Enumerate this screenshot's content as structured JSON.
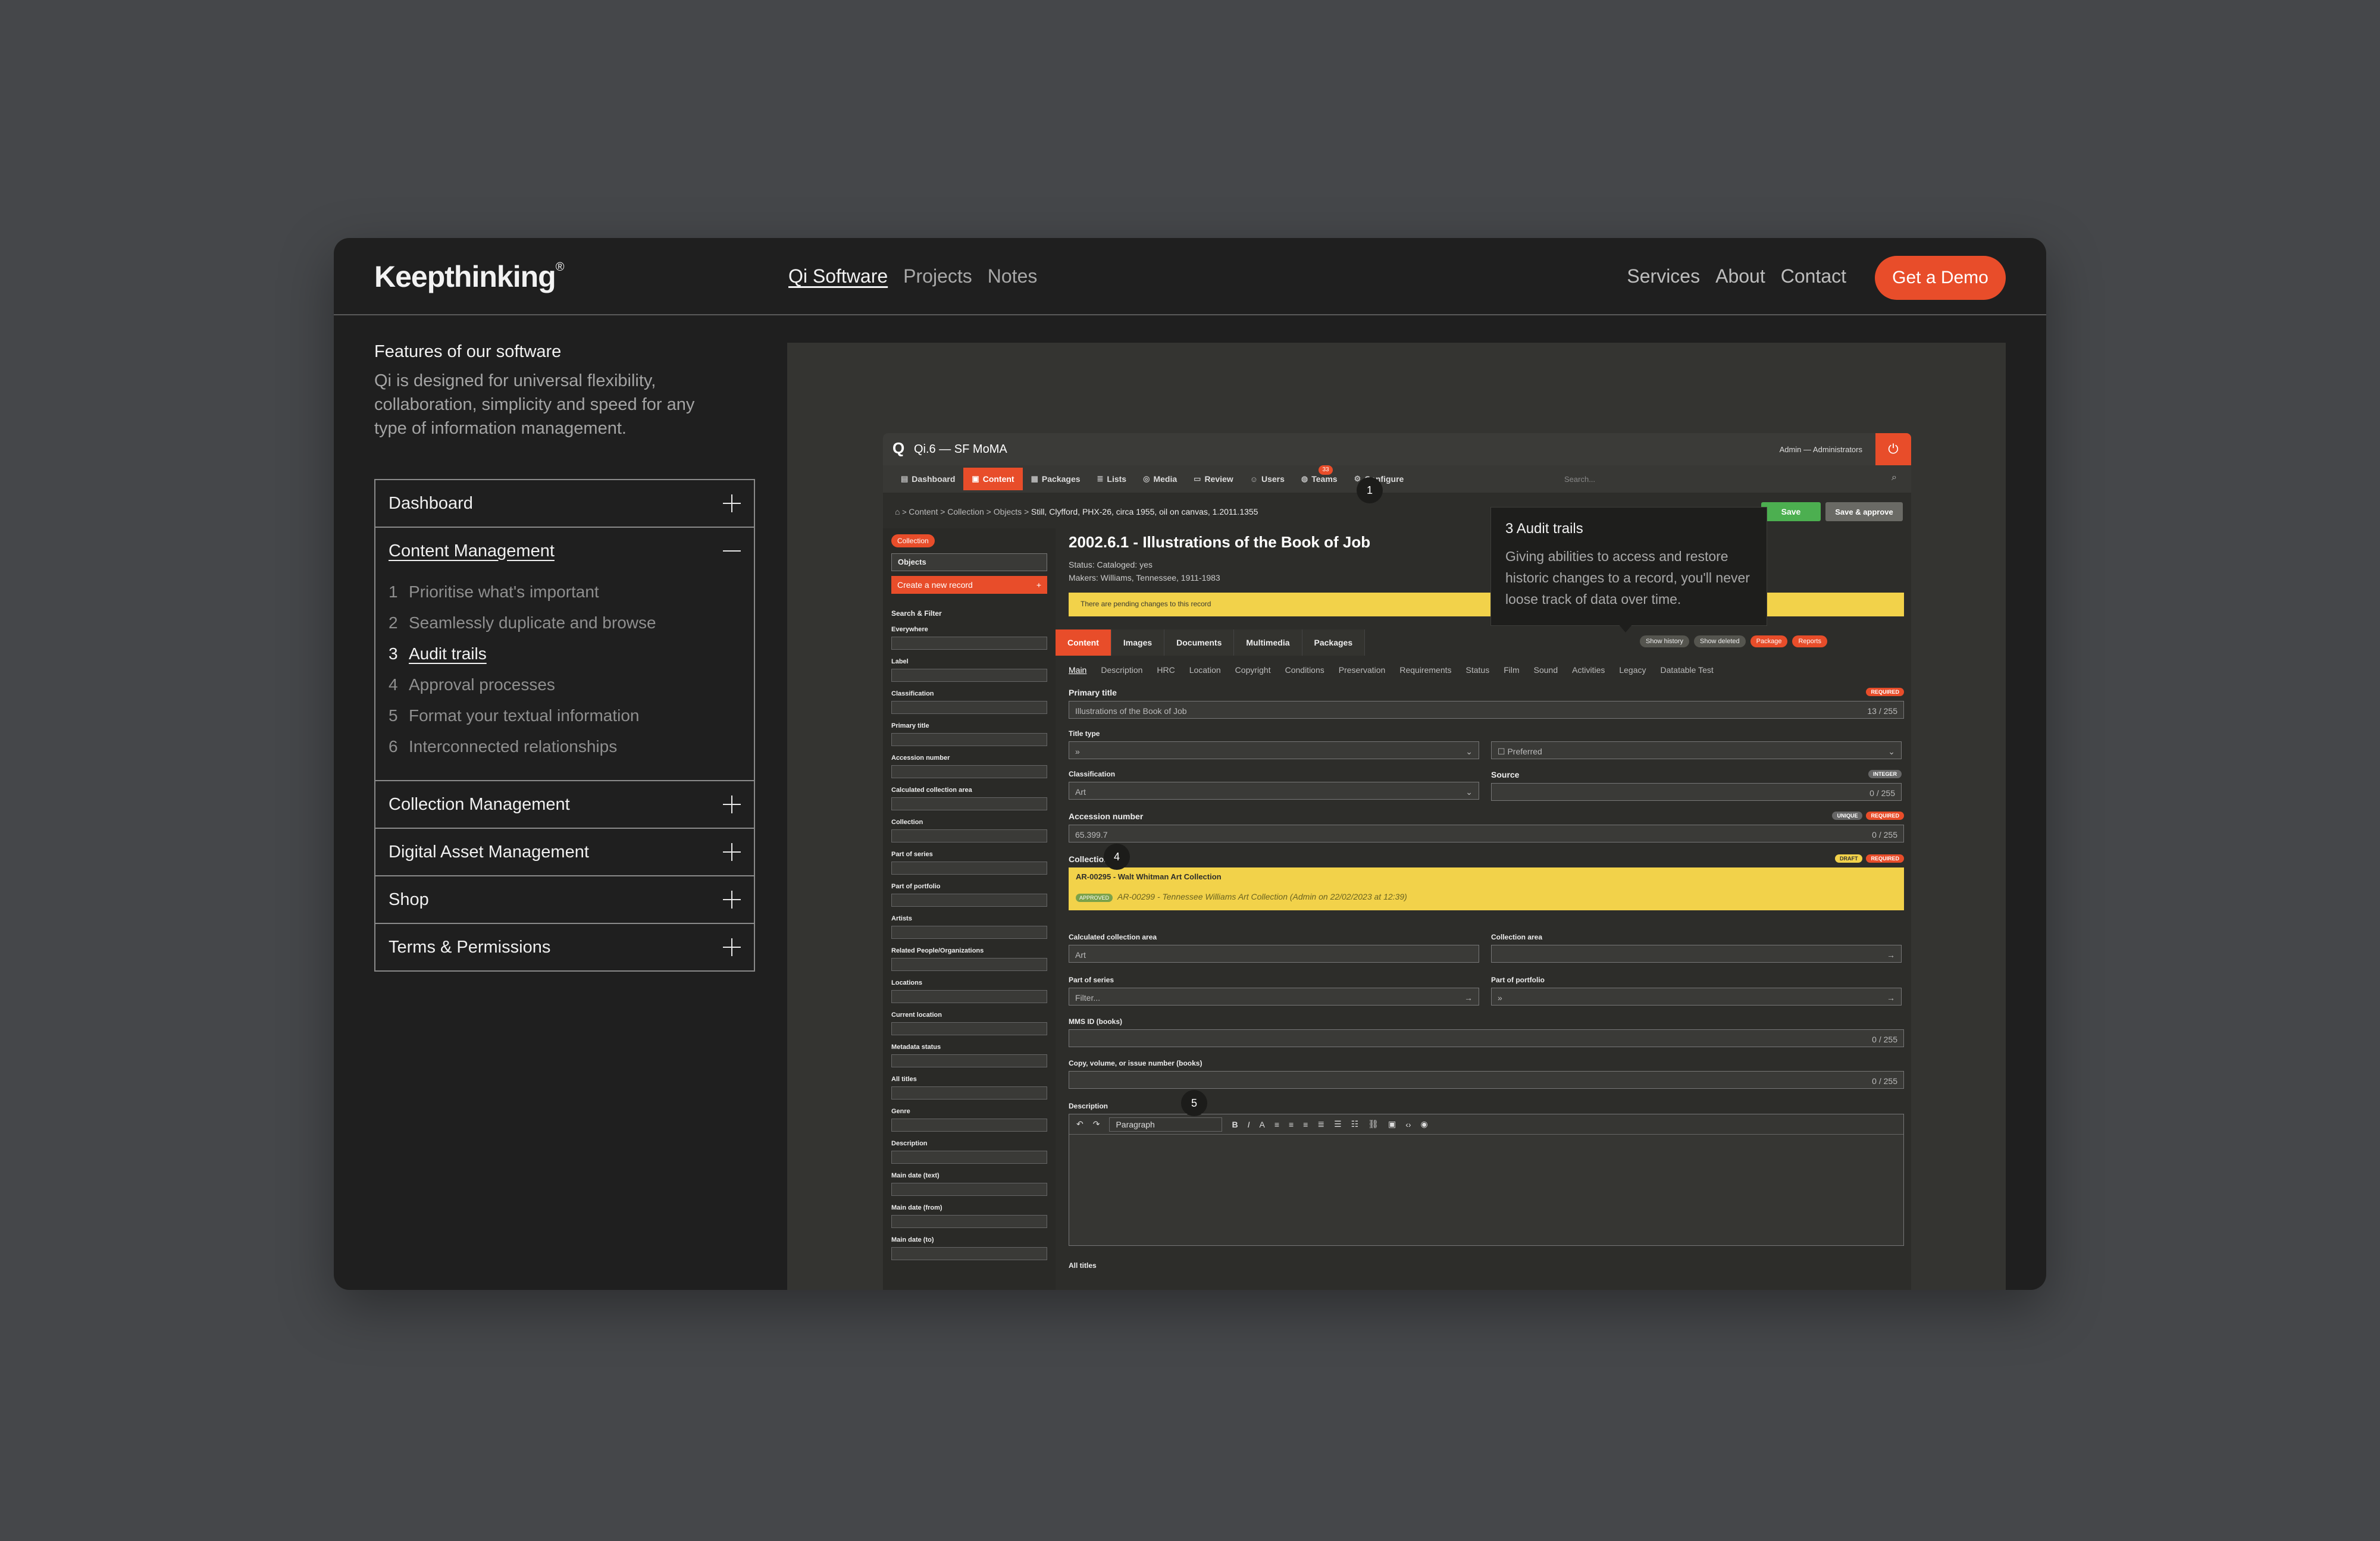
{
  "header": {
    "logo": "Keepthinking",
    "logo_mark": "®",
    "nav_main": [
      "Qi Software",
      "Projects",
      "Notes"
    ],
    "nav_right": [
      "Services",
      "About",
      "Contact"
    ],
    "cta": "Get a Demo"
  },
  "features": {
    "title": "Features of our software",
    "description": "Qi is designed for universal flexibility, collaboration, simplicity and speed for any type of information management.",
    "sections": [
      {
        "label": "Dashboard"
      },
      {
        "label": "Content Management",
        "items": [
          {
            "n": "1",
            "label": "Prioritise what's important"
          },
          {
            "n": "2",
            "label": "Seamlessly duplicate and browse"
          },
          {
            "n": "3",
            "label": "Audit trails"
          },
          {
            "n": "4",
            "label": "Approval processes"
          },
          {
            "n": "5",
            "label": "Format your textual information"
          },
          {
            "n": "6",
            "label": "Interconnected relationships"
          }
        ]
      },
      {
        "label": "Collection Management"
      },
      {
        "label": "Digital Asset Management"
      },
      {
        "label": "Shop"
      },
      {
        "label": "Terms & Permissions"
      }
    ]
  },
  "tooltip": {
    "title": "3  Audit trails",
    "body": "Giving abilities to access and restore historic changes to a record, you'll never loose track of data over time."
  },
  "app": {
    "logo": "Q",
    "title": "Qi.6 — SF MoMA",
    "user": "Admin — Administrators",
    "tabs": [
      "Dashboard",
      "Content",
      "Packages",
      "Lists",
      "Media",
      "Review",
      "Users",
      "Teams",
      "Configure"
    ],
    "review_badge": "33",
    "search_placeholder": "Search...",
    "breadcrumb": "Content > Collection > Objects >",
    "breadcrumb_current": "Still, Clyfford, PHX-26, circa 1955, oil on canvas, 1.2011.1355",
    "save": "Save",
    "save_approve": "Save & approve",
    "side": {
      "collection_pill": "Collection",
      "objects": "Objects",
      "create": "Create a new record",
      "search_filter": "Search & Filter",
      "fields": [
        "Everywhere",
        "Label",
        "Classification",
        "Primary title",
        "Accession number",
        "Calculated collection area",
        "Collection",
        "Part of series",
        "Part of portfolio",
        "Artists",
        "Related People/Organizations",
        "Locations",
        "Current location",
        "Metadata status",
        "All titles",
        "Genre",
        "Description",
        "Main date (text)",
        "Main date (from)",
        "Main date (to)"
      ]
    },
    "record": {
      "title": "2002.6.1 - Illustrations of the Book of Job",
      "status": "Status: Cataloged: yes",
      "makers": "Makers: Williams, Tennessee, 1911-1983",
      "pending": "There are pending changes to this record",
      "tabs": [
        "Content",
        "Images",
        "Documents",
        "Multimedia",
        "Packages"
      ],
      "actions": [
        "Show history",
        "Show deleted",
        "Package",
        "Reports"
      ],
      "subtabs": [
        "Main",
        "Description",
        "HRC",
        "Location",
        "Copyright",
        "Conditions",
        "Preservation",
        "Requirements",
        "Status",
        "Film",
        "Sound",
        "Activities",
        "Legacy",
        "Datatable Test"
      ],
      "primary_title_label": "Primary title",
      "primary_title_value": "Illustrations of the Book of Job",
      "primary_title_count": "13 / 255",
      "title_type_label": "Title type",
      "preferred": "Preferred",
      "classification_label": "Classification",
      "classification_value": "Art",
      "source_label": "Source",
      "accession_label": "Accession number",
      "accession_value": "65.399.7",
      "collection_label": "Collection",
      "collection_value": "AR-00295 - Walt Whitman Art Collection",
      "collection_approved": "APPROVED",
      "collection_prev": "AR-00299 - Tennessee Williams Art Collection (Admin on 22/02/2023 at 12:39)",
      "calc_area_label": "Calculated collection area",
      "calc_area_value": "Art",
      "coll_area_label": "Collection area",
      "series_label": "Part of series",
      "series_value": "Filter...",
      "portfolio_label": "Part of portfolio",
      "mms_label": "MMS ID (books)",
      "copy_label": "Copy, volume, or issue number (books)",
      "desc_label": "Description",
      "paragraph": "Paragraph",
      "all_titles_label": "All titles",
      "count_zero": "0 / 255",
      "tag_required": "REQUIRED",
      "tag_unique": "UNIQUE",
      "tag_integer": "INTEGER",
      "tag_draft": "DRAFT"
    },
    "markers": [
      "1",
      "4",
      "5"
    ]
  }
}
